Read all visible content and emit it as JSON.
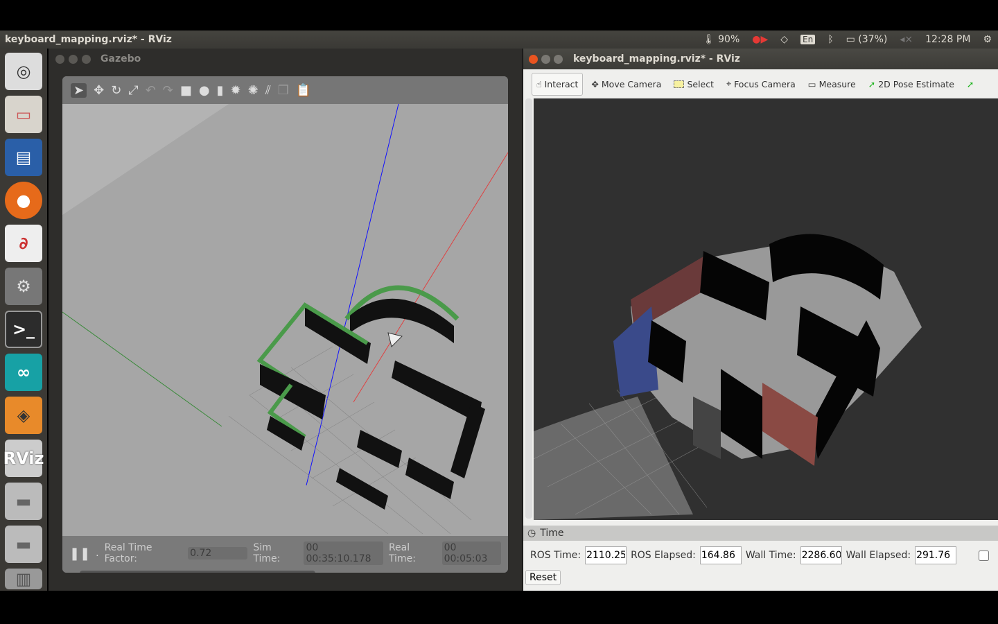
{
  "panel": {
    "title": "keyboard_mapping.rviz* - RViz",
    "temperature": "90%",
    "keyboard": "En",
    "battery": "(37%)",
    "clock": "12:28 PM"
  },
  "launcher": {
    "items": [
      "ubuntu-dash",
      "files",
      "writer",
      "firefox",
      "document-viewer",
      "system-settings",
      "terminal",
      "arduino",
      "sketchup",
      "RViz",
      "disk-1",
      "disk-2",
      "trash"
    ]
  },
  "gazebo": {
    "title": "Gazebo",
    "real_time_factor_label": "Real Time Factor:",
    "real_time_factor": "0.72",
    "sim_time_label": "Sim Time:",
    "sim_time": "00 00:35:10.178",
    "real_time_label": "Real Time:",
    "real_time": "00 00:05:03"
  },
  "rviz": {
    "title": "keyboard_mapping.rviz* - RViz",
    "tools": [
      "Interact",
      "Move Camera",
      "Select",
      "Focus Camera",
      "Measure",
      "2D Pose Estimate"
    ],
    "time_panel": {
      "title": "Time",
      "ros_time_label": "ROS Time:",
      "ros_time": "2110.25",
      "ros_elapsed_label": "ROS Elapsed:",
      "ros_elapsed": "164.86",
      "wall_time_label": "Wall Time:",
      "wall_time": "2286.60",
      "wall_elapsed_label": "Wall Elapsed:",
      "wall_elapsed": "291.76",
      "reset": "Reset"
    }
  },
  "colors": {
    "accent_green": "#1db31d",
    "close_red": "#e95420"
  }
}
